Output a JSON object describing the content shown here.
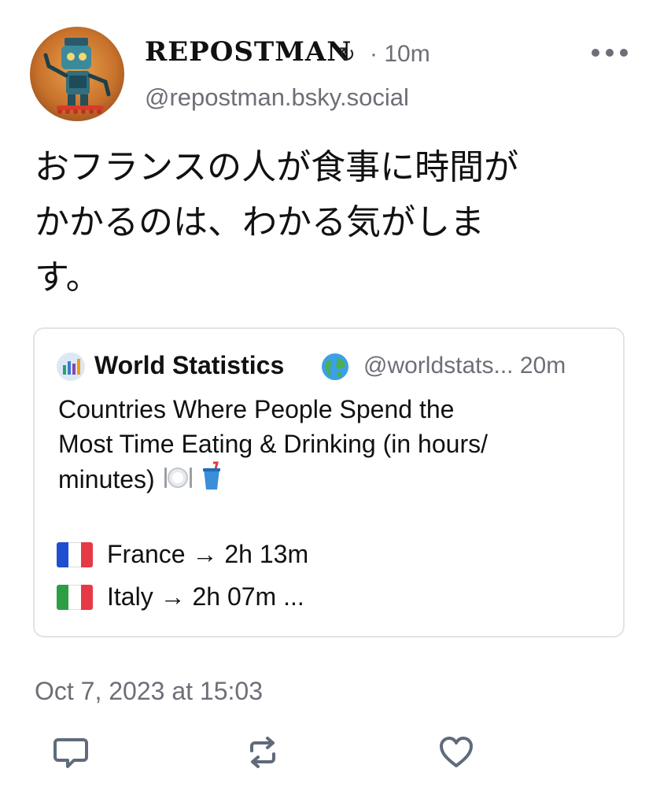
{
  "post": {
    "display_name": "REPOSTMAN",
    "repost_glyph": "↻",
    "time": "· 10m",
    "handle": "@repostman.bsky.social",
    "text_lines": [
      "おフランスの人が食事に時間が",
      "かかるのは、わかる気がしま",
      "す。"
    ],
    "timestamp": "Oct 7, 2023 at 15:03"
  },
  "quote": {
    "name": "World Statistics",
    "handle_time": "@worldstats... 20m",
    "text_lines": [
      "Countries Where People Spend the",
      "Most Time Eating & Drinking (in hours/",
      "minutes)"
    ],
    "rows": [
      {
        "text": "France → 2h 13m",
        "flag_colors": [
          "#1f4fd1",
          "#ffffff",
          "#e63946"
        ]
      },
      {
        "text": "Italy → 2h 07m ...",
        "flag_colors": [
          "#2e9e45",
          "#ffffff",
          "#e63946"
        ]
      }
    ]
  },
  "icons": {
    "more": "more-icon",
    "reply": "reply-icon",
    "repost": "repost-icon",
    "like": "heart-icon"
  },
  "colors": {
    "muted": "#6e6e78",
    "border": "#e1e3e8"
  }
}
